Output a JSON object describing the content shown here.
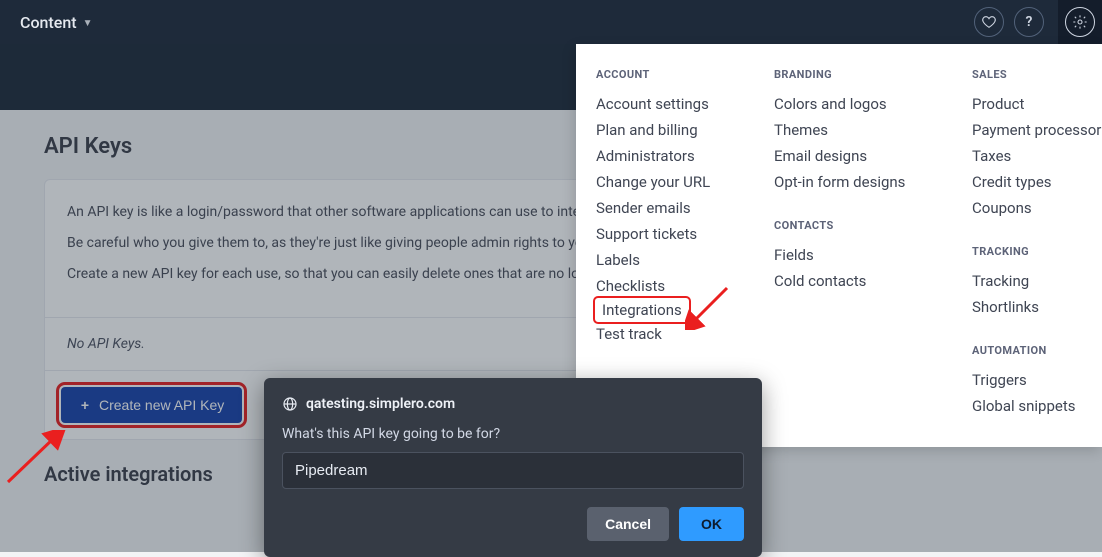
{
  "topbar": {
    "nav_label": "Content"
  },
  "page": {
    "title": "API Keys",
    "desc1": "An API key is like a login/password that other software applications can use to interact with your account.",
    "desc2": "Be careful who you give them to, as they're just like giving people admin rights to your account.",
    "desc3": "Create a new API key for each use, so that you can easily delete ones that are no longer needed.",
    "empty_text": "No API Keys.",
    "create_btn": "Create new API Key",
    "active_title": "Active integrations"
  },
  "menu": {
    "account": {
      "heading": "ACCOUNT",
      "items": [
        "Account settings",
        "Plan and billing",
        "Administrators",
        "Change your URL",
        "Sender emails",
        "Support tickets",
        "Labels",
        "Checklists",
        "Integrations",
        "Test track"
      ]
    },
    "branding": {
      "heading": "BRANDING",
      "items": [
        "Colors and logos",
        "Themes",
        "Email designs",
        "Opt-in form designs"
      ]
    },
    "contacts": {
      "heading": "CONTACTS",
      "items": [
        "Fields",
        "Cold contacts"
      ]
    },
    "sales": {
      "heading": "SALES",
      "items": [
        "Product",
        "Payment processors",
        "Taxes",
        "Credit types",
        "Coupons"
      ]
    },
    "tracking": {
      "heading": "TRACKING",
      "items": [
        "Tracking",
        "Shortlinks"
      ]
    },
    "automation": {
      "heading": "AUTOMATION",
      "items": [
        "Triggers",
        "Global snippets"
      ]
    }
  },
  "modal": {
    "host": "qatesting.simplero.com",
    "label": "What's this API key going to be for?",
    "value": "Pipedream",
    "cancel": "Cancel",
    "ok": "OK"
  }
}
